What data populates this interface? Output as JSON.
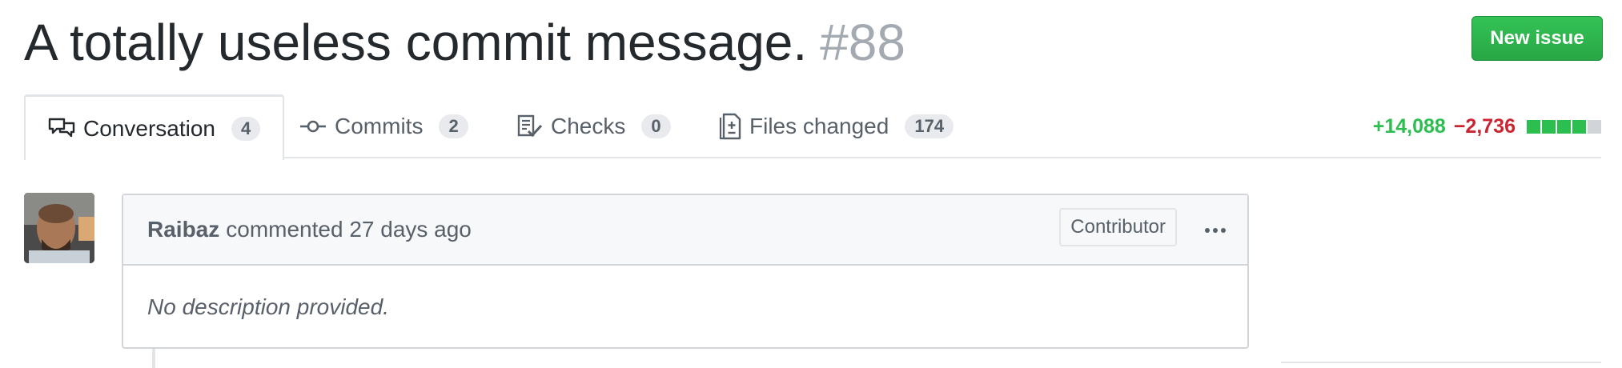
{
  "header": {
    "title": "A totally useless commit message.",
    "number": "#88",
    "new_issue_label": "New issue"
  },
  "tabs": [
    {
      "label": "Conversation",
      "count": "4",
      "icon": "conversation-icon"
    },
    {
      "label": "Commits",
      "count": "2",
      "icon": "commit-icon"
    },
    {
      "label": "Checks",
      "count": "0",
      "icon": "checklist-icon"
    },
    {
      "label": "Files changed",
      "count": "174",
      "icon": "file-diff-icon"
    }
  ],
  "diffstat": {
    "additions": "+14,088",
    "deletions": "−2,736",
    "blocks": [
      "green",
      "green",
      "green",
      "green",
      "gray"
    ],
    "colors": {
      "green": "#2cbe4e",
      "gray": "#d1d5da",
      "red": "#cb2431"
    }
  },
  "comment": {
    "author": "Raibaz",
    "meta": "commented 27 days ago",
    "badge": "Contributor",
    "body": "No description provided."
  },
  "colors": {
    "accent_green": "#28a745",
    "pr_number": "#a3aab1"
  }
}
